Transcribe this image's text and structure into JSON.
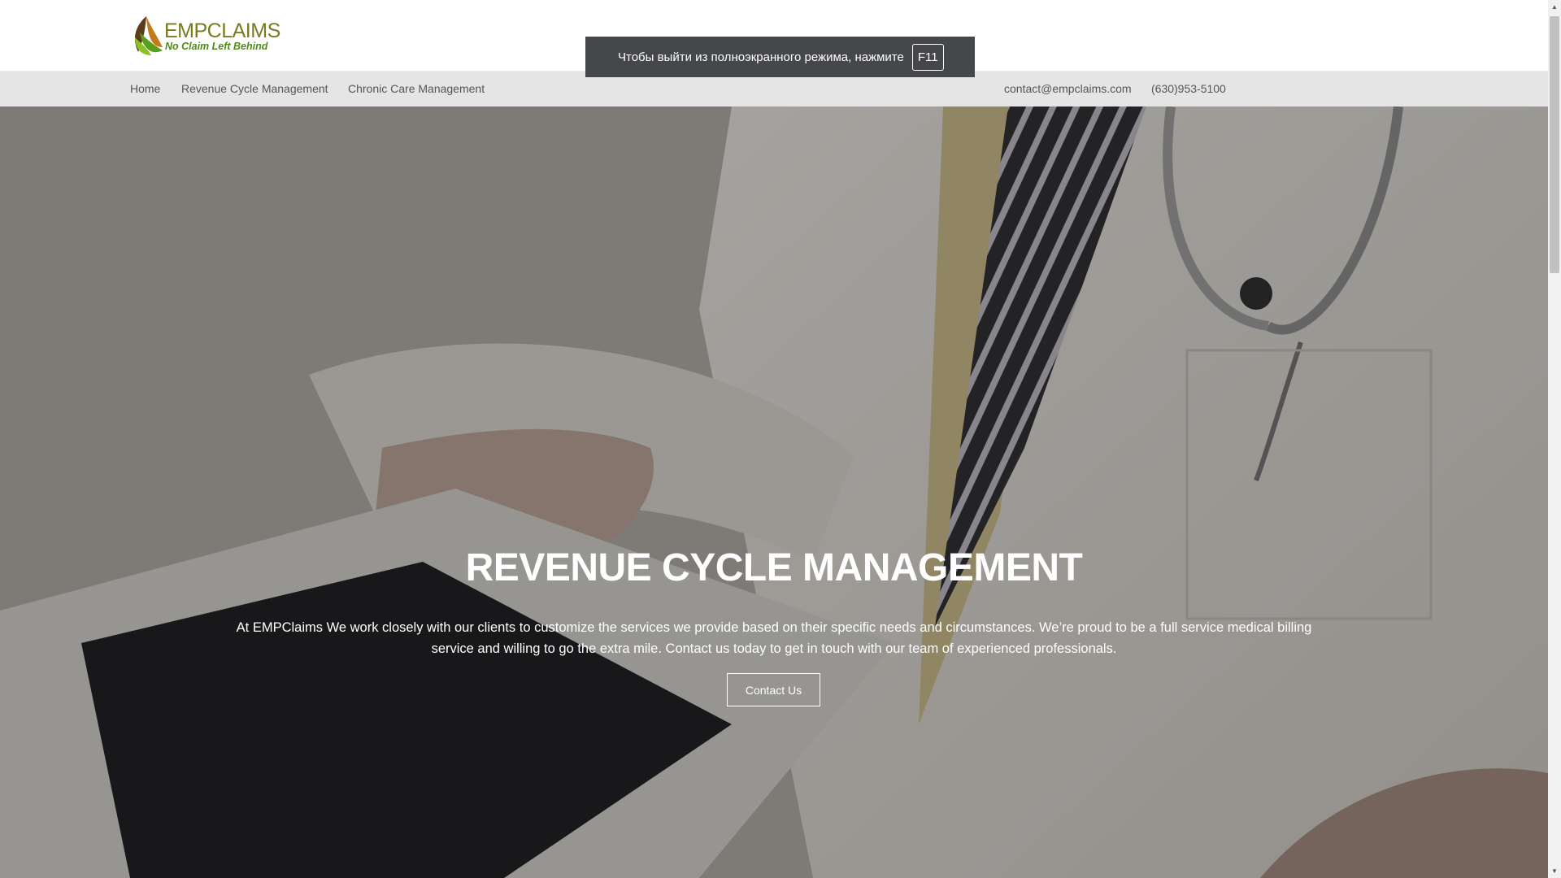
{
  "logo": {
    "name": "EMPCLAIMS",
    "tagline": "No Claim Left Behind"
  },
  "nav": {
    "items": [
      {
        "label": "Home"
      },
      {
        "label": "Revenue Cycle Management"
      },
      {
        "label": "Chronic Care Management"
      }
    ],
    "email": "contact@empclaims.com",
    "phone": "(630)953-5100"
  },
  "hero": {
    "title": "REVENUE CYCLE MANAGEMENT",
    "text": "At EMPClaims We work closely with our clients to customize the services we provide based on their specific needs and circumstances. We’re proud to be a full service medical billing service and willing to go the extra mile. Contact us today to get in touch with our team of experienced professionals.",
    "button_label": "Contact Us"
  },
  "toast": {
    "message": "Чтобы выйти из полноэкранного режима, нажмите",
    "key": "F11"
  },
  "colors": {
    "logo_green": "#4f8b19",
    "logo_olive": "#7a7a1e",
    "nav_bg": "#e5e5e5",
    "toast_bg": "#45474a"
  }
}
